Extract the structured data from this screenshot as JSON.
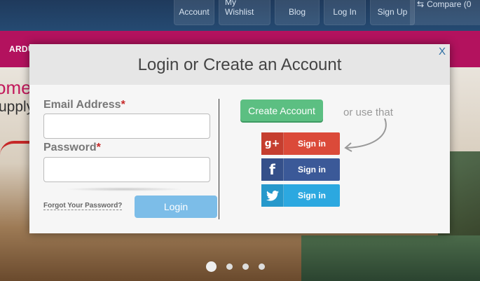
{
  "topnav": {
    "items": [
      "Account",
      "My Wishlist",
      "Blog",
      "Log In",
      "Sign Up"
    ],
    "compare": "Compare (0"
  },
  "category_bar": {
    "label": "ARDUI"
  },
  "hero": {
    "promo1": "ome",
    "promo2": "upply"
  },
  "modal": {
    "title": "Login or Create an Account",
    "close": "X",
    "email_label": "Email Address",
    "password_label": "Password",
    "required_mark": "*",
    "forgot_link": "Forgot Your Password?",
    "login_button": "Login",
    "create_account_button": "Create Account",
    "or_text": "or use that",
    "social": [
      {
        "icon": "google-plus-icon",
        "glyph": "g+",
        "label": "Sign in"
      },
      {
        "icon": "facebook-icon",
        "glyph": "f",
        "label": "Sign in"
      },
      {
        "icon": "twitter-icon",
        "glyph": "",
        "label": "Sign in"
      }
    ]
  },
  "colors": {
    "accent_magenta": "#b3125e",
    "login_button": "#7cbde8",
    "create_button": "#5cbf82",
    "google": "#db4a39",
    "facebook": "#3b5998",
    "twitter": "#2ca8e0"
  },
  "slider": {
    "dot_count": 4,
    "active_index": 0
  }
}
